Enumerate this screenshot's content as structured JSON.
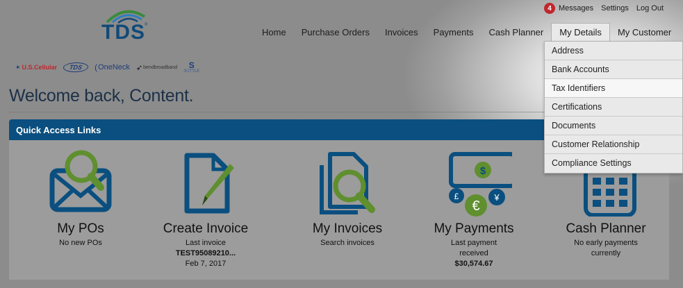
{
  "logo": {
    "text": "TDS",
    "reg": "®"
  },
  "utility": {
    "messages_count": "4",
    "messages_label": "Messages",
    "settings_label": "Settings",
    "logout_label": "Log Out"
  },
  "nav": {
    "items": [
      {
        "label": "Home"
      },
      {
        "label": "Purchase Orders"
      },
      {
        "label": "Invoices"
      },
      {
        "label": "Payments"
      },
      {
        "label": "Cash Planner"
      },
      {
        "label": "My Details"
      },
      {
        "label": "My Customer"
      }
    ]
  },
  "brands": {
    "us_cellular": "U.S.Cellular",
    "tds": "TDS",
    "oneneck": "OneNeck",
    "bend": "bendbroadband",
    "suttle": "SUTTLE"
  },
  "welcome": "Welcome back, Content.",
  "panel": {
    "title": "Quick Access Links"
  },
  "cards": [
    {
      "title": "My POs",
      "sub1": "No new POs"
    },
    {
      "title": "Create Invoice",
      "sub1": "Last invoice",
      "sub2": "TEST95089210...",
      "sub3": "Feb 7, 2017"
    },
    {
      "title": "My Invoices",
      "sub1": "Search invoices"
    },
    {
      "title": "My Payments",
      "sub1": "Last payment",
      "sub2": "received",
      "sub3": "$30,574.67",
      "currency_dollar": "$",
      "currency_pound": "£",
      "currency_euro": "€",
      "currency_yen": "¥"
    },
    {
      "title": "Cash Planner",
      "sub1": "No early payments",
      "sub2": "currently"
    }
  ],
  "dropdown": {
    "items": [
      "Address",
      "Bank Accounts",
      "Tax Identifiers",
      "Certifications",
      "Documents",
      "Customer Relationship",
      "Compliance Settings"
    ]
  },
  "colors": {
    "brand_blue": "#0a4f7f",
    "accent_green": "#5f8f2e",
    "badge_red": "#c0272d"
  }
}
